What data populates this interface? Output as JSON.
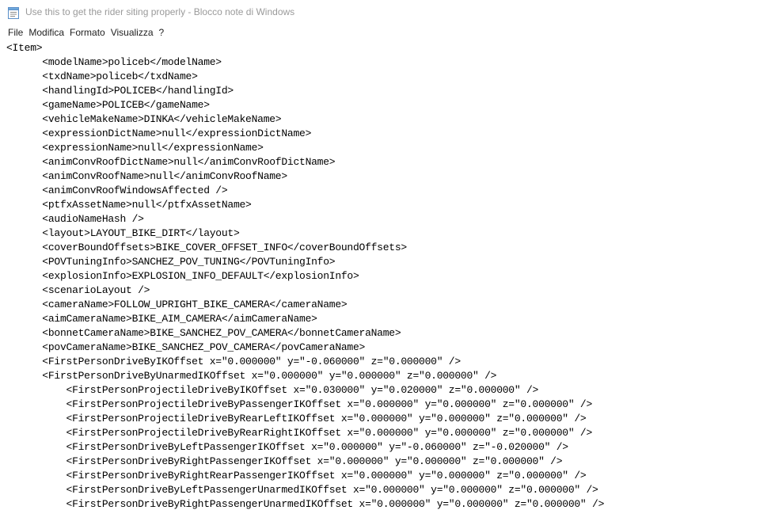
{
  "window": {
    "title": "Use this to get the rider siting properly - Blocco note di Windows",
    "icon": "notepad-icon"
  },
  "menu": [
    "File",
    "Modifica",
    "Formato",
    "Visualizza",
    "?"
  ],
  "editor": {
    "lines": [
      "<Item>",
      "      <modelName>policeb</modelName>",
      "      <txdName>policeb</txdName>",
      "      <handlingId>POLICEB</handlingId>",
      "      <gameName>POLICEB</gameName>",
      "      <vehicleMakeName>DINKA</vehicleMakeName>",
      "      <expressionDictName>null</expressionDictName>",
      "      <expressionName>null</expressionName>",
      "      <animConvRoofDictName>null</animConvRoofDictName>",
      "      <animConvRoofName>null</animConvRoofName>",
      "      <animConvRoofWindowsAffected />",
      "      <ptfxAssetName>null</ptfxAssetName>",
      "      <audioNameHash />",
      "      <layout>LAYOUT_BIKE_DIRT</layout>",
      "      <coverBoundOffsets>BIKE_COVER_OFFSET_INFO</coverBoundOffsets>",
      "      <POVTuningInfo>SANCHEZ_POV_TUNING</POVTuningInfo>",
      "      <explosionInfo>EXPLOSION_INFO_DEFAULT</explosionInfo>",
      "      <scenarioLayout />",
      "      <cameraName>FOLLOW_UPRIGHT_BIKE_CAMERA</cameraName>",
      "      <aimCameraName>BIKE_AIM_CAMERA</aimCameraName>",
      "      <bonnetCameraName>BIKE_SANCHEZ_POV_CAMERA</bonnetCameraName>",
      "      <povCameraName>BIKE_SANCHEZ_POV_CAMERA</povCameraName>",
      "      <FirstPersonDriveByIKOffset x=\"0.000000\" y=\"-0.060000\" z=\"0.000000\" />",
      "      <FirstPersonDriveByUnarmedIKOffset x=\"0.000000\" y=\"0.000000\" z=\"0.000000\" />",
      "          <FirstPersonProjectileDriveByIKOffset x=\"0.030000\" y=\"0.020000\" z=\"0.000000\" />",
      "          <FirstPersonProjectileDriveByPassengerIKOffset x=\"0.000000\" y=\"0.000000\" z=\"0.000000\" />",
      "          <FirstPersonProjectileDriveByRearLeftIKOffset x=\"0.000000\" y=\"0.000000\" z=\"0.000000\" />",
      "          <FirstPersonProjectileDriveByRearRightIKOffset x=\"0.000000\" y=\"0.000000\" z=\"0.000000\" />",
      "          <FirstPersonDriveByLeftPassengerIKOffset x=\"0.000000\" y=\"-0.060000\" z=\"-0.020000\" />",
      "          <FirstPersonDriveByRightPassengerIKOffset x=\"0.000000\" y=\"0.000000\" z=\"0.000000\" />",
      "          <FirstPersonDriveByRightRearPassengerIKOffset x=\"0.000000\" y=\"0.000000\" z=\"0.000000\" />",
      "          <FirstPersonDriveByLeftPassengerUnarmedIKOffset x=\"0.000000\" y=\"0.000000\" z=\"0.000000\" />",
      "          <FirstPersonDriveByRightPassengerUnarmedIKOffset x=\"0.000000\" y=\"0.000000\" z=\"0.000000\" />"
    ]
  }
}
